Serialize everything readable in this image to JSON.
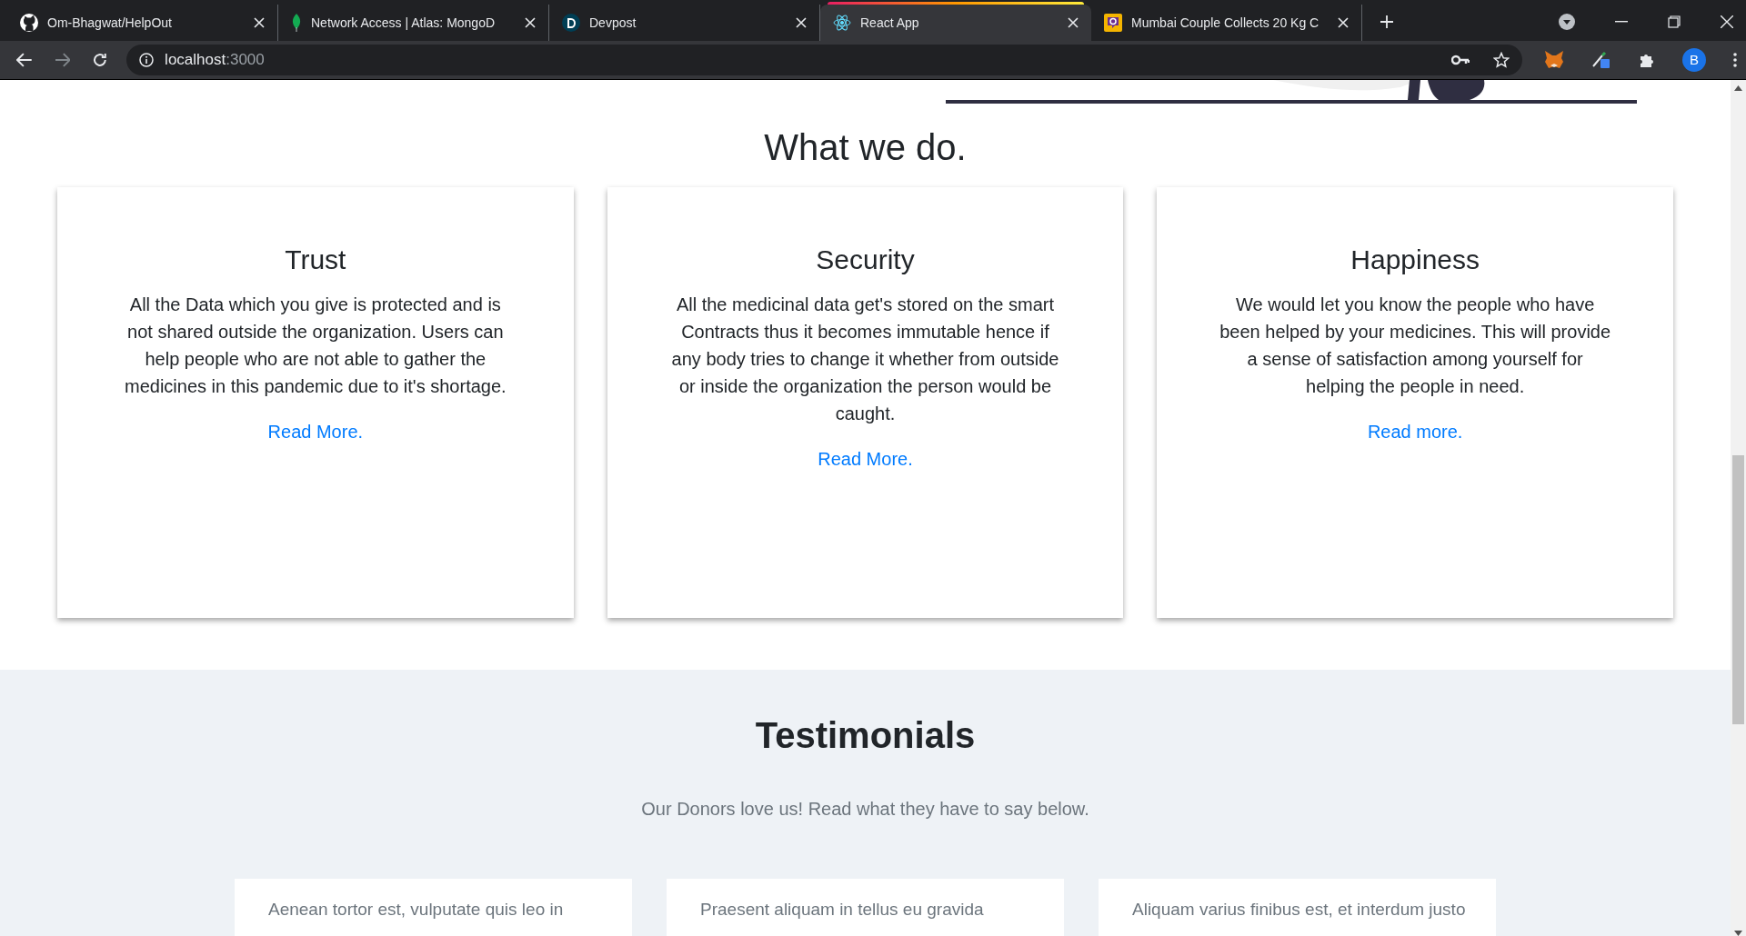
{
  "browser": {
    "tabs": [
      {
        "title": "Om-Bhagwat/HelpOut",
        "selected": false
      },
      {
        "title": "Network Access | Atlas: MongoD",
        "selected": false
      },
      {
        "title": "Devpost",
        "selected": false
      },
      {
        "title": "React App",
        "selected": true
      },
      {
        "title": "Mumbai Couple Collects 20 Kg C",
        "selected": false
      }
    ],
    "url_host": "localhost",
    "url_port": ":3000",
    "profile_initial": "B"
  },
  "what_we_do": {
    "heading": "What we do.",
    "cards": [
      {
        "title": "Trust",
        "body": "All the Data which you give is protected and is not shared outside the organization. Users can help people who are not able to gather the medicines in this pandemic due to it's shortage.",
        "link": "Read More."
      },
      {
        "title": "Security",
        "body": "All the medicinal data get's stored on the smart Contracts thus it becomes immutable hence if any body tries to change it whether from outside or inside the organization the person would be caught.",
        "link": "Read More."
      },
      {
        "title": "Happiness",
        "body": "We would let you know the people who have been helped by your medicines. This will provide a sense of satisfaction among yourself for helping the people in need.",
        "link": "Read more."
      }
    ]
  },
  "testimonials": {
    "heading": "Testimonials",
    "subtitle": "Our Donors love us! Read what they have to say below.",
    "cards": [
      {
        "text": "Aenean tortor est, vulputate quis leo in"
      },
      {
        "text": "Praesent aliquam in tellus eu gravida"
      },
      {
        "text": "Aliquam varius finibus est, et interdum justo"
      }
    ]
  }
}
